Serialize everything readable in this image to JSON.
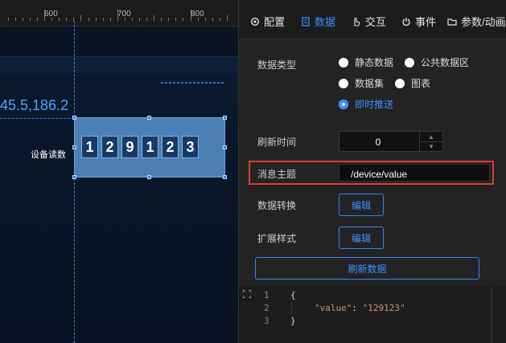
{
  "ruler": {
    "marks": [
      "600",
      "700",
      "800"
    ]
  },
  "canvas": {
    "coord_text": "45.5,186.2",
    "device_label": "设备读数",
    "digits": [
      "1",
      "2",
      "9",
      "1",
      "2",
      "3"
    ]
  },
  "tabs": [
    {
      "label": "配置",
      "icon": "gear-icon"
    },
    {
      "label": "数据",
      "icon": "data-icon",
      "active": true
    },
    {
      "label": "交互",
      "icon": "pointer-icon"
    },
    {
      "label": "事件",
      "icon": "power-icon"
    },
    {
      "label": "参数/动画",
      "icon": "folder-icon"
    }
  ],
  "form": {
    "data_type_label": "数据类型",
    "options": {
      "static": "静态数据",
      "public": "公共数据区",
      "dataset": "数据集",
      "chart": "图表",
      "push": "即时推送"
    },
    "selected_option": "即时推送",
    "refresh_label": "刷新时间",
    "refresh_value": "0",
    "topic_label": "消息主题",
    "topic_value": "/device/value",
    "convert_label": "数据转换",
    "convert_button": "编辑",
    "style_label": "扩展样式",
    "style_button": "编辑",
    "refresh_data_button": "刷新数据"
  },
  "code": {
    "line_numbers": [
      "1",
      "2",
      "3"
    ],
    "line1": "{",
    "key": "\"value\"",
    "colon": ": ",
    "value": "\"129123\"",
    "line3": "}"
  },
  "colors": {
    "accent": "#1e7cff",
    "highlight": "#e23b2e"
  }
}
